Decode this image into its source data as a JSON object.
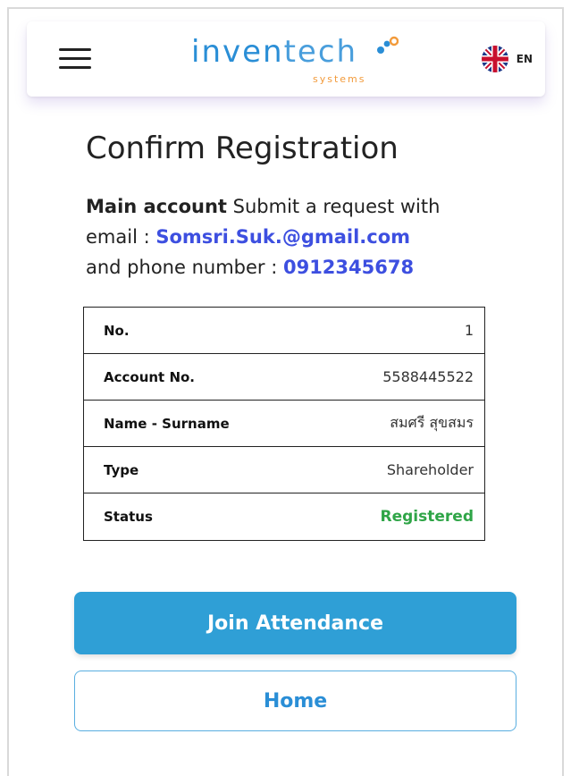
{
  "header": {
    "logo_text_main": "inven",
    "logo_text_tail": "tech",
    "logo_sub": "systems",
    "language": "EN"
  },
  "page": {
    "title": "Confirm Registration",
    "intro_bold": "Main account",
    "intro_text": " Submit a request with",
    "email_label": "email  : ",
    "email": "Somsri.Suk.@gmail.com",
    "phone_label": "and phone number : ",
    "phone": "0912345678"
  },
  "table": {
    "rows": [
      {
        "label": "No.",
        "value": "1"
      },
      {
        "label": "Account No.",
        "value": "5588445522"
      },
      {
        "label": "Name - Surname",
        "value": "สมศรี สุขสมร"
      },
      {
        "label": "Type",
        "value": "Shareholder"
      },
      {
        "label": "Status",
        "value": "Registered"
      }
    ]
  },
  "actions": {
    "join_label": "Join Attendance",
    "home_label": "Home"
  },
  "colors": {
    "accent": "#2f9fd6",
    "link": "#3d4fe0",
    "status_ok": "#2fa547",
    "logo_orange": "#f29a3a"
  },
  "icons": {
    "menu": "hamburger-menu-icon",
    "flag": "uk-flag-icon"
  }
}
